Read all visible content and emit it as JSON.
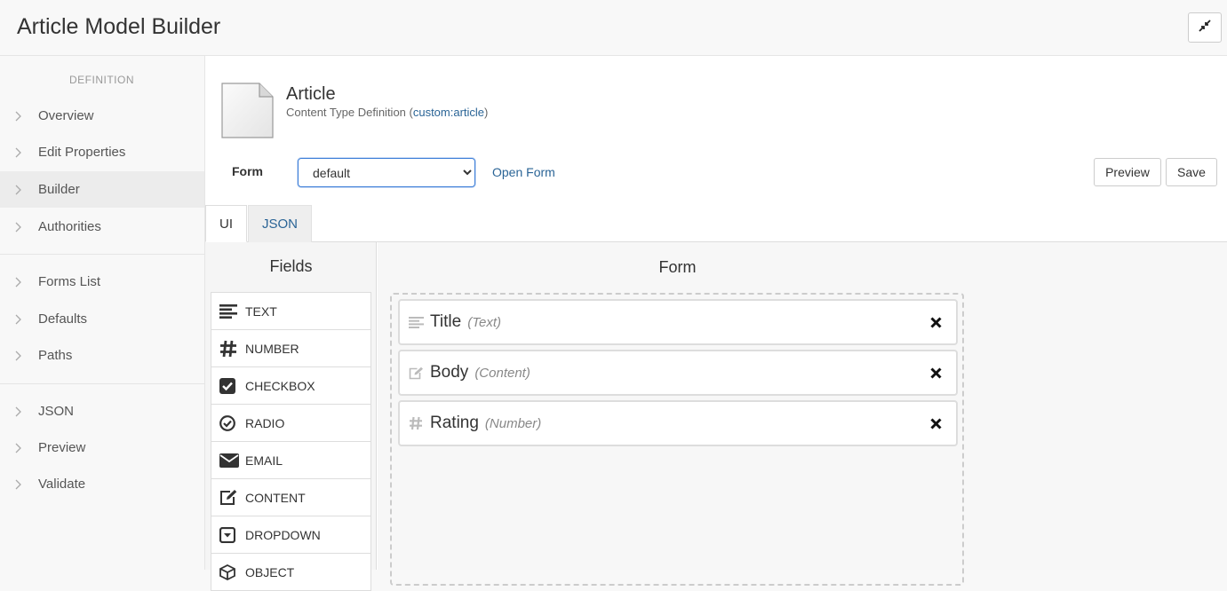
{
  "header": {
    "title": "Article Model Builder",
    "collapse_icon": "compress-icon"
  },
  "sidebar": {
    "heading": "DEFINITION",
    "items": [
      {
        "label": "Overview"
      },
      {
        "label": "Edit Properties"
      },
      {
        "label": "Builder",
        "active": true
      },
      {
        "label": "Authorities"
      },
      {
        "label": "Forms List"
      },
      {
        "label": "Defaults"
      },
      {
        "label": "Paths"
      },
      {
        "label": "JSON"
      },
      {
        "label": "Preview"
      },
      {
        "label": "Validate"
      }
    ]
  },
  "type_info": {
    "name": "Article",
    "subtitle_prefix": "Content Type Definition (",
    "qname": "custom:article",
    "subtitle_suffix": ")"
  },
  "form_bar": {
    "label": "Form",
    "selected": "default",
    "open_link": "Open Form",
    "preview_button": "Preview",
    "save_button": "Save"
  },
  "tabs": [
    {
      "label": "UI",
      "active": true
    },
    {
      "label": "JSON",
      "active": false
    }
  ],
  "fields_panel": {
    "title": "Fields",
    "items": [
      {
        "label": "TEXT",
        "icon": "align-left-icon"
      },
      {
        "label": "NUMBER",
        "icon": "hash-icon"
      },
      {
        "label": "CHECKBOX",
        "icon": "checkbox-checked-icon"
      },
      {
        "label": "RADIO",
        "icon": "check-circle-icon"
      },
      {
        "label": "EMAIL",
        "icon": "envelope-icon"
      },
      {
        "label": "CONTENT",
        "icon": "edit-icon"
      },
      {
        "label": "DROPDOWN",
        "icon": "caret-square-icon"
      },
      {
        "label": "OBJECT",
        "icon": "cube-icon"
      }
    ]
  },
  "form_panel": {
    "title": "Form",
    "fields": [
      {
        "name": "Title",
        "type": "(Text)",
        "icon": "align-left-icon"
      },
      {
        "name": "Body",
        "type": "(Content)",
        "icon": "edit-icon"
      },
      {
        "name": "Rating",
        "type": "(Number)",
        "icon": "hash-icon"
      }
    ]
  }
}
